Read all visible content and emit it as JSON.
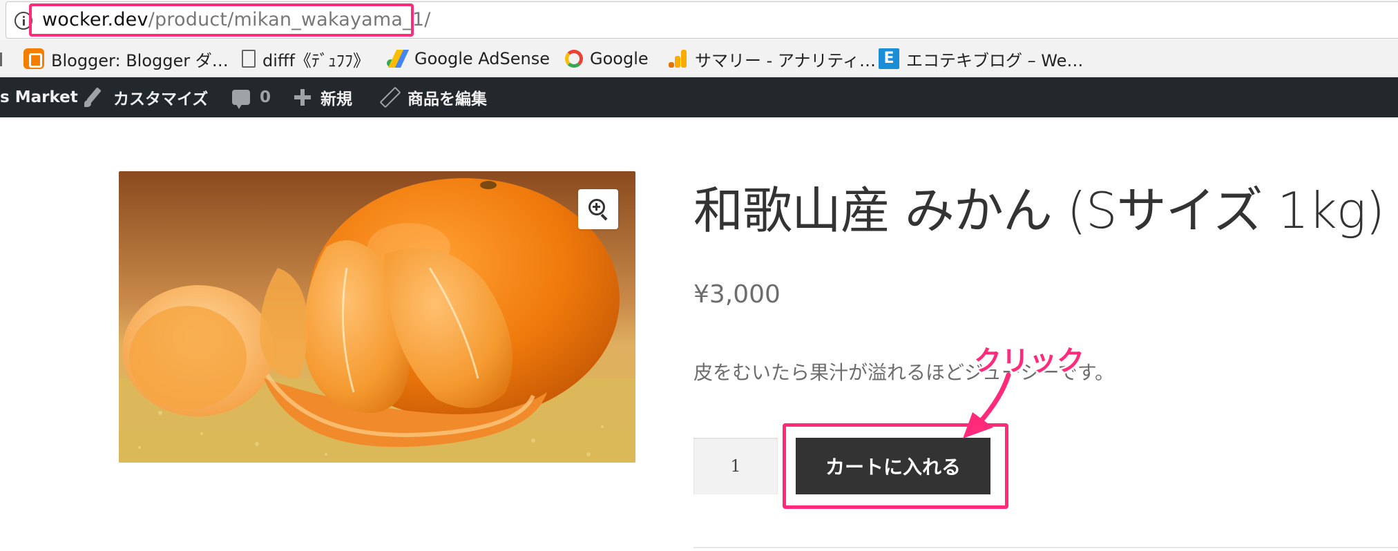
{
  "browser": {
    "url_host": "wocker.dev",
    "url_path": "/product/mikan_wakayama_1/",
    "highlight_color": "#ff2a7a"
  },
  "bookmarks": [
    {
      "label": "Blogger: Blogger ダ…",
      "icon": "blogger-icon"
    },
    {
      "label": "difff《ﾃﾞｭﾌﾌ》",
      "icon": "document-icon"
    },
    {
      "label": "Google AdSense",
      "icon": "adsense-icon"
    },
    {
      "label": "Google",
      "icon": "google-icon"
    },
    {
      "label": "サマリー - アナリティ…",
      "icon": "analytics-icon"
    },
    {
      "label": "エコテキブログ – We…",
      "icon": "ecotech-icon"
    }
  ],
  "adminbar": {
    "site_name": "s Market",
    "customize": "カスタマイズ",
    "comments_count": "0",
    "new": "新規",
    "edit_product": "商品を編集"
  },
  "product": {
    "title_main": "和歌山産 みかん",
    "title_size": "(Sサイズ 1kg)",
    "price": "¥3,000",
    "description": "皮をむいたら果汁が溢れるほどジューシーです。",
    "quantity": "1",
    "add_to_cart": "カートに入れる",
    "image_subject": "mandarin oranges"
  },
  "annotation": {
    "label": "クリック",
    "color": "#ff2a7a"
  }
}
